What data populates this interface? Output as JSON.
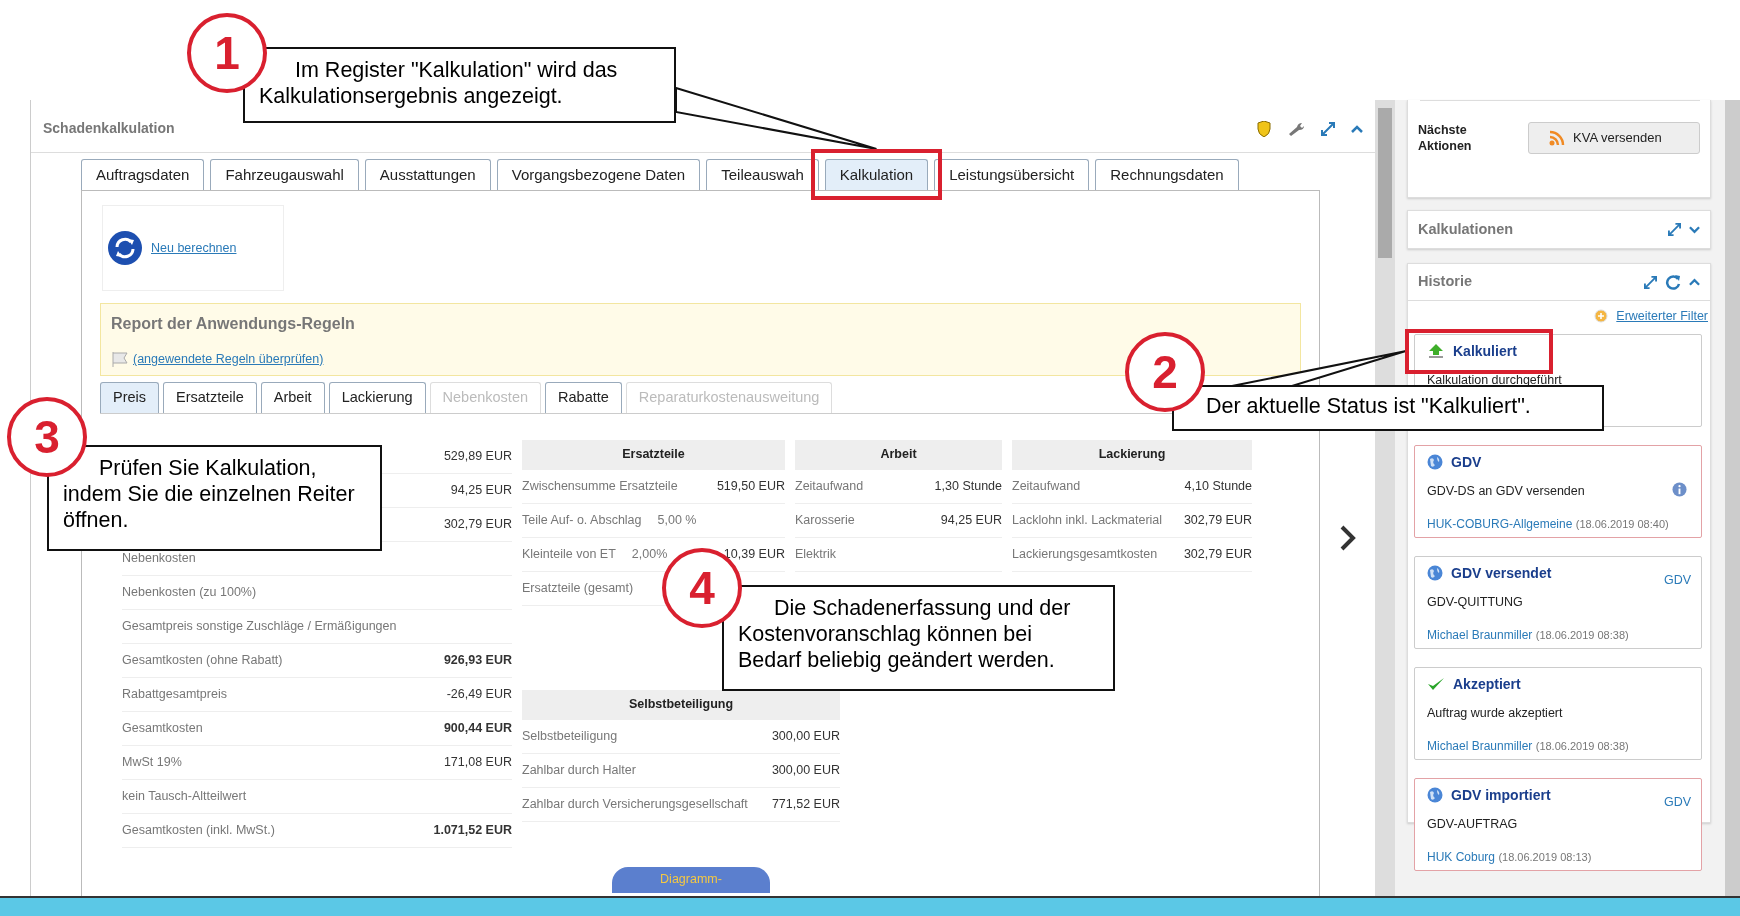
{
  "panel": {
    "title": "Schadenkalkulation"
  },
  "tabs": [
    {
      "label": "Auftragsdaten",
      "selected": false
    },
    {
      "label": "Fahrzeugauswahl",
      "selected": false
    },
    {
      "label": "Ausstattungen",
      "selected": false
    },
    {
      "label": "Vorgangsbezogene Daten",
      "selected": false
    },
    {
      "label": "Teileauswah",
      "selected": false
    },
    {
      "label": "Kalkulation",
      "selected": true
    },
    {
      "label": "Leistungsübersicht",
      "selected": false
    },
    {
      "label": "Rechnungsdaten",
      "selected": false
    }
  ],
  "recalc_button": {
    "label": "Neu berechnen"
  },
  "rules_report": {
    "title": "Report der Anwendungs-Regeln",
    "link": "(angewendete Regeln überprüfen)"
  },
  "sub_tabs": [
    {
      "label": "Preis",
      "selected": true,
      "disabled": false
    },
    {
      "label": "Ersatzteile",
      "selected": false,
      "disabled": false
    },
    {
      "label": "Arbeit",
      "selected": false,
      "disabled": false
    },
    {
      "label": "Lackierung",
      "selected": false,
      "disabled": false
    },
    {
      "label": "Nebenkosten",
      "selected": false,
      "disabled": true
    },
    {
      "label": "Rabatte",
      "selected": false,
      "disabled": false
    },
    {
      "label": "Reparaturkostenausweitung",
      "selected": false,
      "disabled": true
    }
  ],
  "summary_rows": [
    {
      "value": "529,89 EUR"
    },
    {
      "value": "94,25 EUR"
    },
    {
      "value": "302,79 EUR"
    },
    {
      "label": "Nebenkosten"
    },
    {
      "label": "Nebenkosten (zu 100%)"
    },
    {
      "label": "Gesamtpreis sonstige Zuschläge / Ermäßigungen"
    },
    {
      "label": "Gesamtkosten (ohne Rabatt)",
      "value": "926,93 EUR",
      "bold": true
    },
    {
      "label": "Rabattgesamtpreis",
      "value": "-26,49 EUR"
    },
    {
      "label": "Gesamtkosten",
      "value": "900,44 EUR",
      "bold": true
    },
    {
      "label": "MwSt 19%",
      "value": "171,08 EUR"
    },
    {
      "label": "kein Tausch-Altteilwert"
    },
    {
      "label": "Gesamtkosten (inkl. MwSt.)",
      "value": "1.071,52 EUR",
      "bold": true
    }
  ],
  "detail_tables": [
    {
      "title": "Ersatzteile",
      "rows": [
        {
          "label": "Zwischensumme Ersatzteile",
          "value": "519,50 EUR"
        },
        {
          "label": "Teile Auf- o. Abschlag",
          "rate": "5,00 %"
        },
        {
          "label": "Kleinteile von ET",
          "rate": "2,00%",
          "value": "10,39 EUR"
        },
        {
          "label": "Ersatzteile (gesamt)"
        }
      ]
    },
    {
      "title": "Arbeit",
      "rows": [
        {
          "label": "Zeitaufwand",
          "value": "1,30 Stunde"
        },
        {
          "label": "Karosserie",
          "value": "94,25 EUR"
        },
        {
          "label": "Elektrik"
        }
      ]
    },
    {
      "title": "Lackierung",
      "rows": [
        {
          "label": "Zeitaufwand",
          "value": "4,10 Stunde"
        },
        {
          "label": "Lacklohn inkl. Lackmaterial",
          "value": "302,79 EUR"
        },
        {
          "label": "Lackierungsgesamtkosten",
          "value": "302,79 EUR"
        }
      ]
    }
  ],
  "deductible_table": {
    "title": "Selbstbeteiligung",
    "rows": [
      {
        "label": "Selbstbeteiligung",
        "value": "300,00 EUR"
      },
      {
        "label": "Zahlbar durch Halter",
        "value": "300,00 EUR"
      },
      {
        "label": "Zahlbar durch Versicherungsgesellschaft",
        "value": "771,52 EUR"
      }
    ]
  },
  "diagram_button": {
    "label": "Diagramm-"
  },
  "sidebar": {
    "next_actions": {
      "label": "Nächste Aktionen",
      "button": "KVA versenden"
    },
    "calculations_panel": {
      "title": "Kalkulationen"
    },
    "history": {
      "title": "Historie",
      "filter": "Erweiterter Filter",
      "entries": [
        {
          "kind": "upload",
          "title": "Kalkuliert",
          "text": "Kalkulation durchgeführt",
          "highlighted": false
        },
        {
          "kind": "globe",
          "title": "GDV",
          "text": "GDV-DS an GDV versenden",
          "info": true,
          "author": "HUK-COBURG-Allgemeine",
          "time": "(18.06.2019 08:40)",
          "highlighted": true
        },
        {
          "kind": "globe",
          "title": "GDV versendet",
          "source": "GDV",
          "text": "GDV-QUITTUNG",
          "author": "Michael Braunmiller",
          "time": "(18.06.2019 08:38)",
          "highlighted": false
        },
        {
          "kind": "check",
          "title": "Akzeptiert",
          "text": "Auftrag wurde akzeptiert",
          "author": "Michael Braunmiller",
          "time": "(18.06.2019 08:38)",
          "highlighted": false
        },
        {
          "kind": "globe",
          "title": "GDV importiert",
          "source": "GDV",
          "text": "GDV-AUFTRAG",
          "author": "HUK Coburg",
          "time": "(18.06.2019 08:13)",
          "highlighted": true
        }
      ]
    }
  },
  "callouts": [
    {
      "number": "1",
      "text": "Im Register \"Kalkulation\" wird das Kalkulationsergebnis angezeigt."
    },
    {
      "number": "2",
      "text": "Der aktuelle Status ist \"Kalkuliert\"."
    },
    {
      "number": "3",
      "text": "Prüfen Sie Kalkulation, indem Sie die einzelnen Reiter öffnen."
    },
    {
      "number": "4",
      "text": "Die Schadenerfassung und der Kostenvoranschlag können bei Bedarf beliebig geändert werden."
    }
  ]
}
